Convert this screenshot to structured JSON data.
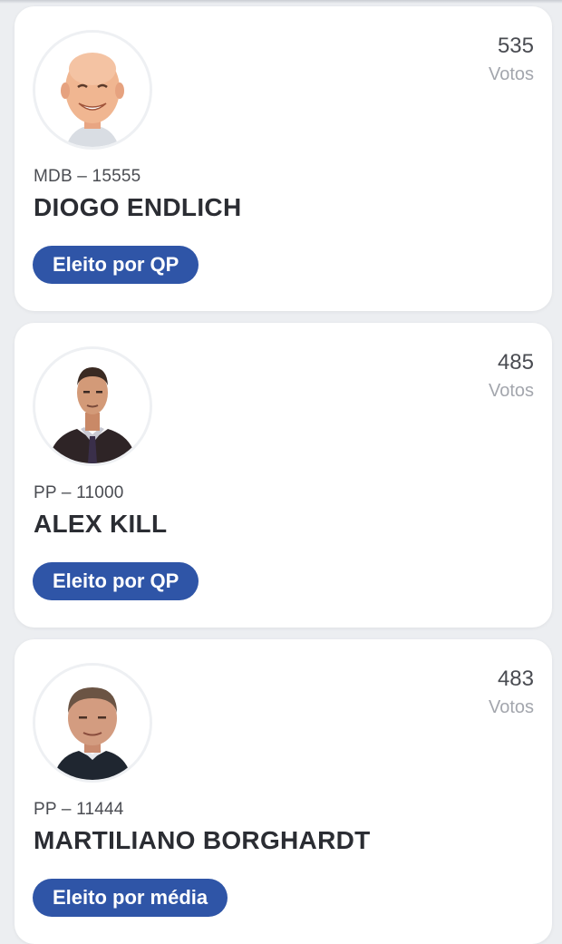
{
  "candidates": [
    {
      "party_number": "MDB – 15555",
      "name": "DIOGO ENDLICH",
      "votes": "535",
      "votes_label": "Votos",
      "status": "Eleito por QP",
      "photo_icon": "candidate-photo-bald-smiling-man"
    },
    {
      "party_number": "PP – 11000",
      "name": "ALEX KILL",
      "votes": "485",
      "votes_label": "Votos",
      "status": "Eleito por QP",
      "photo_icon": "candidate-photo-man-dark-suit"
    },
    {
      "party_number": "PP – 11444",
      "name": "MARTILIANO BORGHARDT",
      "votes": "483",
      "votes_label": "Votos",
      "status": "Eleito por média",
      "photo_icon": "candidate-photo-man-dark-jacket"
    }
  ],
  "colors": {
    "background": "#eceef1",
    "card": "#ffffff",
    "badge": "#2f55a7",
    "name_text": "#2b2d33",
    "votes_label": "#a3a6ad"
  }
}
